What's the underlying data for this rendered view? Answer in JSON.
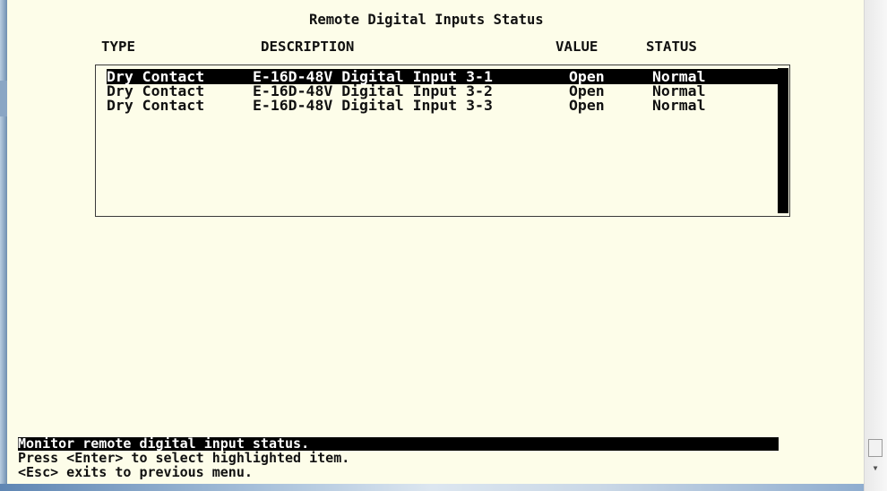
{
  "screen": {
    "title": "Remote Digital Inputs Status"
  },
  "columns": {
    "type": "TYPE",
    "description": "DESCRIPTION",
    "value": "VALUE",
    "status": "STATUS"
  },
  "rows": [
    {
      "type": "Dry Contact",
      "description": "E-16D-48V Digital Input 3-1",
      "value": "Open",
      "status": "Normal",
      "highlighted": true
    },
    {
      "type": "Dry Contact",
      "description": "E-16D-48V Digital Input 3-2",
      "value": "Open",
      "status": "Normal",
      "highlighted": false
    },
    {
      "type": "Dry Contact",
      "description": "E-16D-48V Digital Input 3-3",
      "value": "Open",
      "status": "Normal",
      "highlighted": false
    }
  ],
  "footer": {
    "status_line": "Monitor remote digital input status.",
    "help_line_1": "Press <Enter> to select highlighted item.",
    "help_line_2": "<Esc> exits to previous menu."
  },
  "colors": {
    "terminal_background": "#fdfde9",
    "text": "#111111",
    "highlight_background": "#000000",
    "highlight_text": "#ffffff"
  }
}
